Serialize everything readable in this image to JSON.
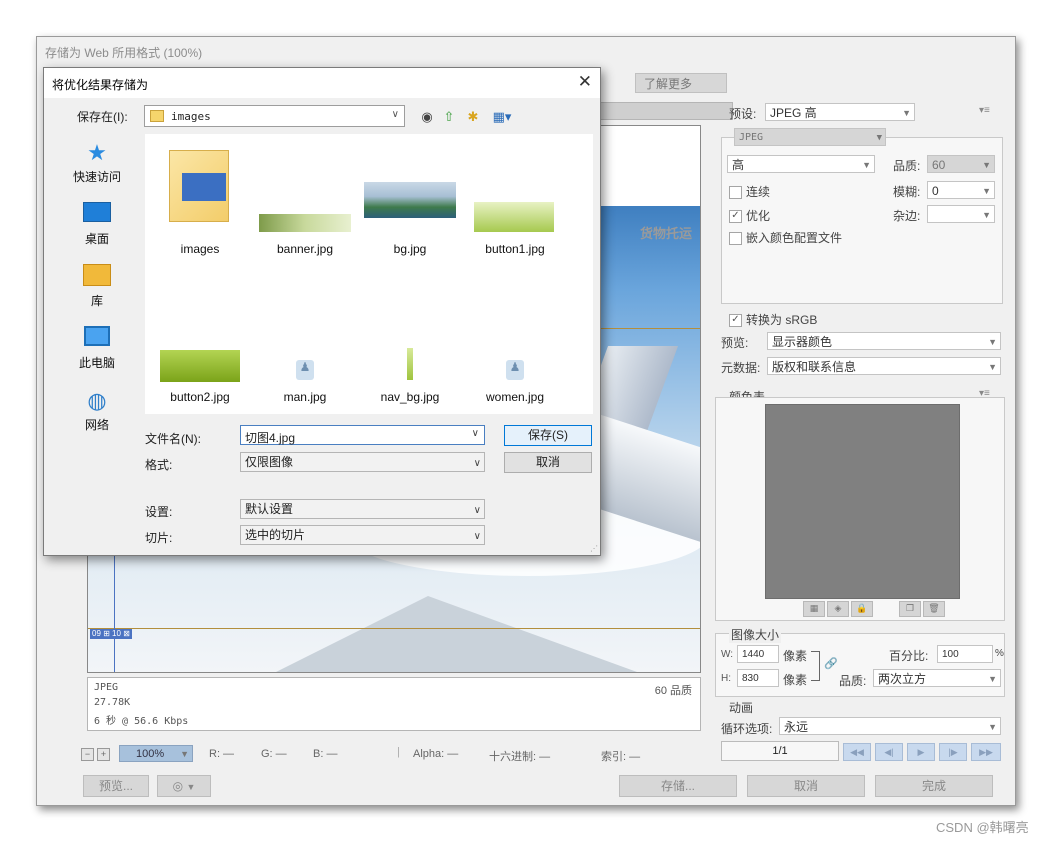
{
  "main_window": {
    "title": "存储为 Web 所用格式 (100%)",
    "learn_more": "了解更多"
  },
  "preview": {
    "cargo_text": "货物托运",
    "slice_tag": "09 ⊞ 10 ⊠",
    "info": {
      "format": "JPEG",
      "size": "27.78K",
      "time": "6 秒 @ 56.6 Kbps",
      "quality": "60 品质"
    }
  },
  "status": {
    "zoom": "100%",
    "r": "R: —",
    "g": "G: —",
    "b": "B: —",
    "alpha": "Alpha: —",
    "hex": "十六进制: —",
    "index": "索引: —"
  },
  "bottom": {
    "preview": "预览...",
    "save": "存储...",
    "cancel": "取消",
    "done": "完成"
  },
  "right_panel": {
    "preset_label": "预设:",
    "preset_value": "JPEG 高",
    "format_value": "JPEG",
    "quality_level": "高",
    "quality_label": "品质:",
    "quality_value": "60",
    "blur_label": "模糊:",
    "blur_value": "0",
    "matte_label": "杂边:",
    "progressive": "连续",
    "optimized": "优化",
    "embed_profile": "嵌入颜色配置文件",
    "convert_srgb": "转换为 sRGB",
    "preview_label": "预览:",
    "preview_value": "显示器颜色",
    "metadata_label": "元数据:",
    "metadata_value": "版权和联系信息",
    "color_table_label": "颜色表",
    "image_size_label": "图像大小",
    "w_label": "W:",
    "w_value": "1440",
    "h_label": "H:",
    "h_value": "830",
    "pixel_unit": "像素",
    "percent_label": "百分比:",
    "percent_value": "100",
    "percent_unit": "%",
    "resample_label": "品质:",
    "resample_value": "两次立方",
    "animation_label": "动画",
    "loop_label": "循环选项:",
    "loop_value": "永远",
    "frame_counter": "1/1"
  },
  "dialog": {
    "title": "将优化结果存储为",
    "save_in_label": "保存在(I):",
    "save_in_value": "images",
    "places": [
      "快速访问",
      "桌面",
      "库",
      "此电脑",
      "网络"
    ],
    "files": [
      "images",
      "banner.jpg",
      "bg.jpg",
      "button1.jpg",
      "button2.jpg",
      "man.jpg",
      "nav_bg.jpg",
      "women.jpg"
    ],
    "filename_label": "文件名(N):",
    "filename_value": "切图4.jpg",
    "format_label": "格式:",
    "format_value": "仅限图像",
    "save_button": "保存(S)",
    "cancel_button": "取消",
    "settings_label": "设置:",
    "settings_value": "默认设置",
    "slices_label": "切片:",
    "slices_value": "选中的切片"
  },
  "watermark": "CSDN @韩曙亮"
}
